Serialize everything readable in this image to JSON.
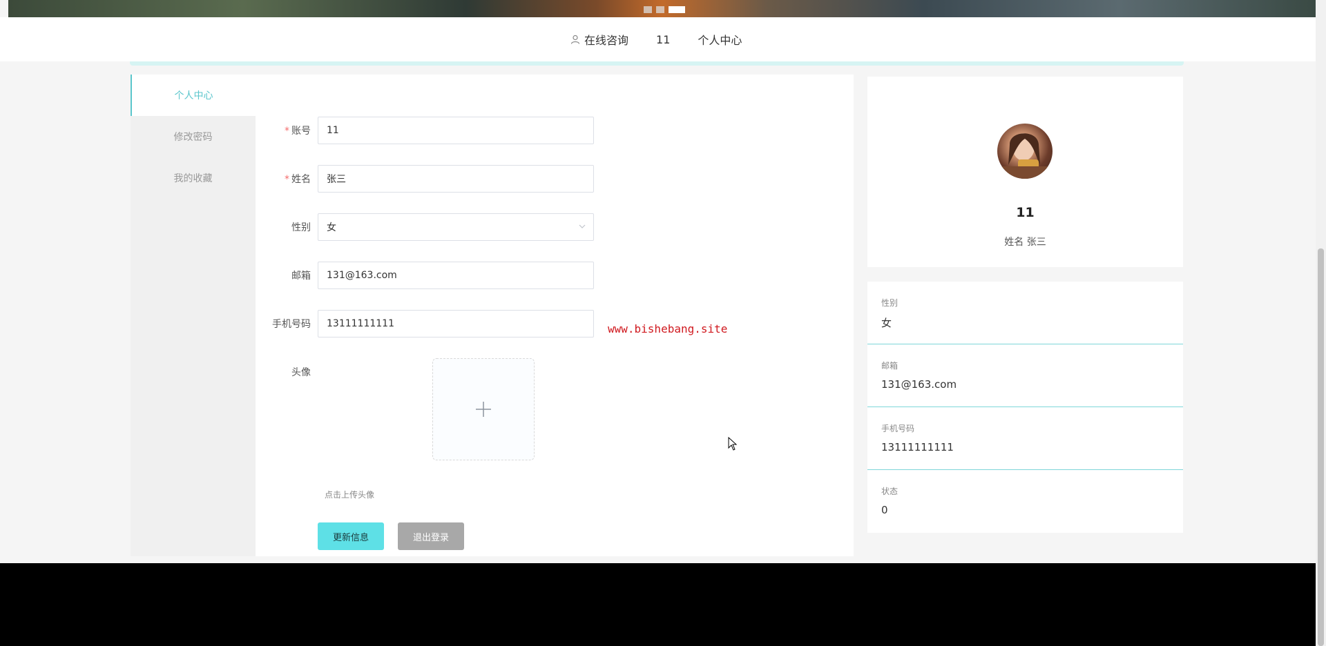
{
  "nav": {
    "consult_label": "在线咨询",
    "username": "11",
    "profile_label": "个人中心"
  },
  "sidebar": {
    "items": [
      {
        "label": "个人中心"
      },
      {
        "label": "修改密码"
      },
      {
        "label": "我的收藏"
      }
    ]
  },
  "form": {
    "account_label": "账号",
    "account_value": "11",
    "name_label": "姓名",
    "name_value": "张三",
    "gender_label": "性别",
    "gender_value": "女",
    "email_label": "邮箱",
    "email_value": "131@163.com",
    "phone_label": "手机号码",
    "phone_value": "13111111111",
    "avatar_label": "头像",
    "upload_hint": "点击上传头像",
    "update_button": "更新信息",
    "logout_button": "退出登录"
  },
  "watermark": "www.bishebang.site",
  "profile": {
    "username": "11",
    "name_line": "姓名 张三"
  },
  "info": [
    {
      "label": "性别",
      "value": "女"
    },
    {
      "label": "邮箱",
      "value": "131@163.com"
    },
    {
      "label": "手机号码",
      "value": "13111111111"
    },
    {
      "label": "状态",
      "value": "0"
    }
  ],
  "colors": {
    "accent": "#5bc6cc",
    "update_button": "#5ee0e6",
    "logout_button": "#a8a8a8",
    "watermark": "#d0191f"
  }
}
